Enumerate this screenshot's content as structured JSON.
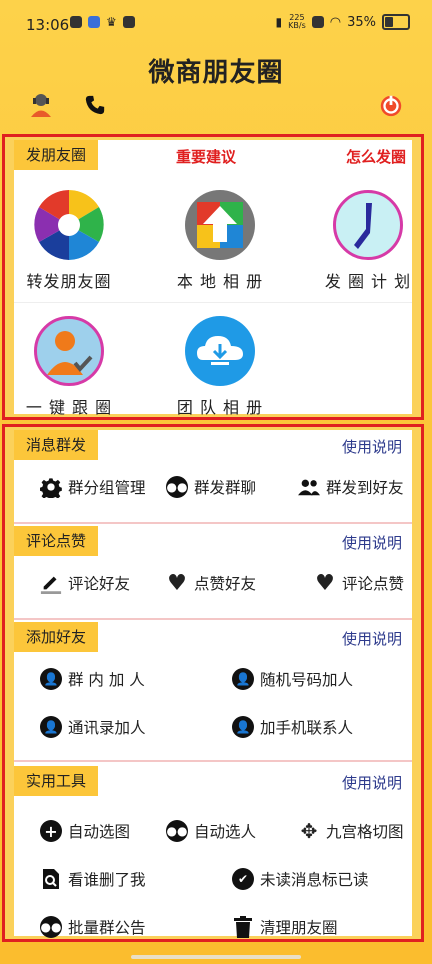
{
  "status": {
    "time": "13:06",
    "net_speed": "225",
    "net_unit": "KB/s",
    "battery": "35%"
  },
  "app": {
    "title": "微商朋友圈"
  },
  "post": {
    "section": "发朋友圈",
    "link_important": "重要建议",
    "link_howto": "怎么发圈",
    "items": [
      {
        "label": "转发朋友圈",
        "icon": "camera-shutter-icon"
      },
      {
        "label": "本 地 相 册",
        "icon": "upload-photo-icon"
      },
      {
        "label": "发 圈 计 划",
        "icon": "clock-icon"
      },
      {
        "label": "一 键 跟 圈",
        "icon": "user-check-icon"
      },
      {
        "label": "团 队 相 册",
        "icon": "cloud-download-icon"
      }
    ]
  },
  "messaging": {
    "section": "消息群发",
    "help": "使用说明",
    "items": [
      {
        "label": "群分组管理",
        "icon": "gear-icon"
      },
      {
        "label": "群发群聊",
        "icon": "group-dots-icon"
      },
      {
        "label": "群发到好友",
        "icon": "people-icon"
      }
    ]
  },
  "comments": {
    "section": "评论点赞",
    "help": "使用说明",
    "items": [
      {
        "label": "评论好友",
        "icon": "pencil-icon"
      },
      {
        "label": "点赞好友",
        "icon": "heart-icon"
      },
      {
        "label": "评论点赞",
        "icon": "heart-icon"
      }
    ]
  },
  "friends": {
    "section": "添加好友",
    "help": "使用说明",
    "items": [
      {
        "label": "群 内 加 人",
        "icon": "user-circle-icon"
      },
      {
        "label": "随机号码加人",
        "icon": "user-circle-icon"
      },
      {
        "label": "通讯录加人",
        "icon": "user-circle-icon"
      },
      {
        "label": "加手机联系人",
        "icon": "user-circle-icon"
      }
    ]
  },
  "tools": {
    "section": "实用工具",
    "help": "使用说明",
    "items": [
      {
        "label": "自动选图",
        "icon": "plus-circle-icon"
      },
      {
        "label": "自动选人",
        "icon": "people-circle-icon"
      },
      {
        "label": "九宫格切图",
        "icon": "move-arrows-icon"
      },
      {
        "label": "看谁删了我",
        "icon": "doc-search-icon"
      },
      {
        "label": "未读消息标已读",
        "icon": "check-badge-icon"
      },
      {
        "label": "批量群公告",
        "icon": "group-dots-icon"
      },
      {
        "label": "清理朋友圈",
        "icon": "trash-icon"
      }
    ]
  }
}
